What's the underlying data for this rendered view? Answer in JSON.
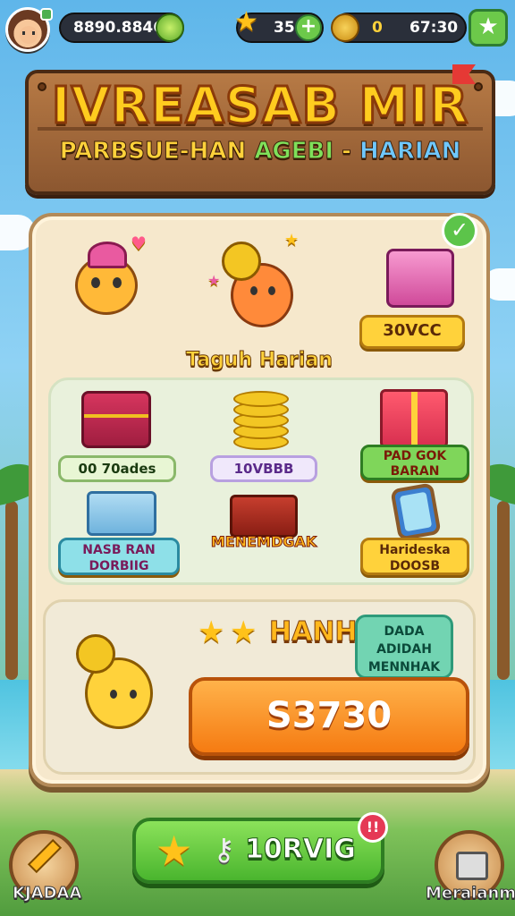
{
  "topbar": {
    "currency_main": "8890.8846",
    "stars": "35",
    "coins": "0",
    "timer": "67:30"
  },
  "banner": {
    "title": "IVREASAB MIR",
    "subtitle_parts": [
      "PARBSUE-HAN",
      "AGEBI",
      "-",
      "HARIAN"
    ]
  },
  "panel": {
    "badge_1": "30VCC",
    "section_title": "Taguh Harian",
    "grid": {
      "item1_label": "00 70ades",
      "item2_label": "10VBBB",
      "item3_label": "PAD GOK BARAN",
      "item4_label": "NASB RAN DORBIIG",
      "item5_label": "MENEMDGAK",
      "item6_label": "Harideska DOOSB"
    },
    "hari_title": "HANH",
    "green_box": "DADA ADIDAH MENNHAK",
    "big_button": "S3730"
  },
  "bottom": {
    "main_label": "10RVIG",
    "notif_count": "!!",
    "left_label": "KJADAA",
    "right_label": "Meraianm"
  },
  "colors": {
    "accent_yellow": "#ffd23b",
    "accent_green": "#5cc44a",
    "accent_orange": "#f57b12"
  }
}
